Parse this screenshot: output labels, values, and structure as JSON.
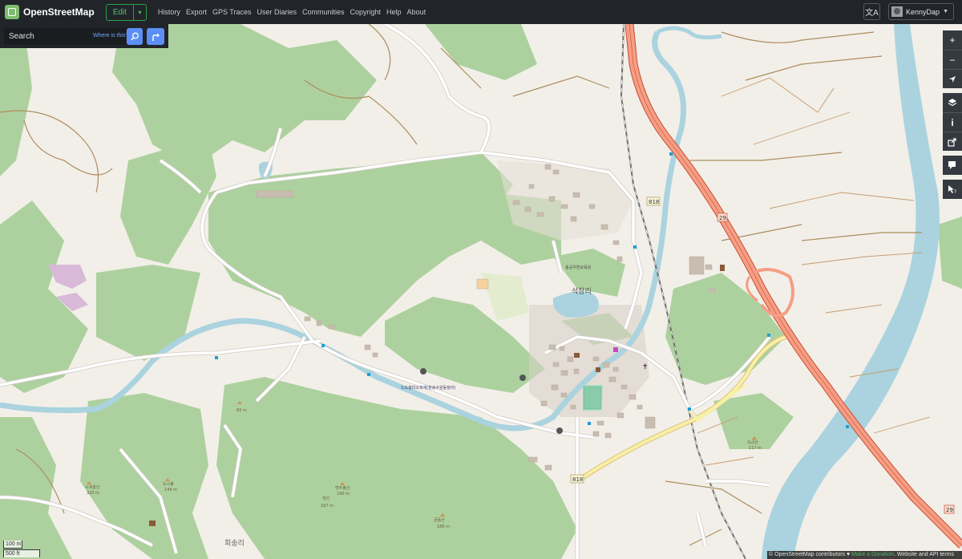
{
  "navbar": {
    "brand": "OpenStreetMap",
    "edit_label": "Edit",
    "links": [
      "History",
      "Export",
      "GPS Traces",
      "User Diaries",
      "Communities",
      "Copyright",
      "Help",
      "About"
    ],
    "user_name": "KennyDap"
  },
  "search": {
    "placeholder": "Search",
    "where_is_this": "Where is this?"
  },
  "map": {
    "place_labels": {
      "village": "석장리",
      "hoesong": "회송리",
      "peak_sokgeumsan": "속금산",
      "peak_sokgeumsan_elev": "117 m",
      "peak_82": "82 m",
      "peak_sisuksan": "시세울산",
      "peak_sisuksan_elev": "320 m",
      "peak_dosibong": "도시봉",
      "peak_dosibong_elev": "146 m",
      "peak_moksan": "맷두봉산",
      "peak_moksan_elev": "190 m",
      "peak_hwaeksan": "학산",
      "peak_hwaeksan_elev": "167 m",
      "peak_gungdong": "궁동산",
      "peak_gungdong_elev": "188 m",
      "school": "충공우연교육원",
      "dam_label": "노도홈미소피재(청송수원동정미)"
    },
    "route_shields": [
      "818",
      "818",
      "29",
      "29"
    ]
  },
  "controls": [
    "zoom-in",
    "zoom-out",
    "locate",
    "layers",
    "map-key",
    "share",
    "add-note",
    "query-features"
  ],
  "scale": {
    "metric": "100 m",
    "imperial": "500 ft"
  },
  "attribution": {
    "copy": "© OpenStreetMap contributors ♥",
    "donate": "Make a Donation",
    "tail": ". Website and API terms"
  },
  "colors": {
    "navbar_bg": "#212529",
    "land": "#f2efe9",
    "forest": "#add19e",
    "water": "#aad3df",
    "trunk_road": "#f9b29c",
    "primary_road": "#fcd6a4",
    "accent_blue": "#5c8ff6"
  }
}
